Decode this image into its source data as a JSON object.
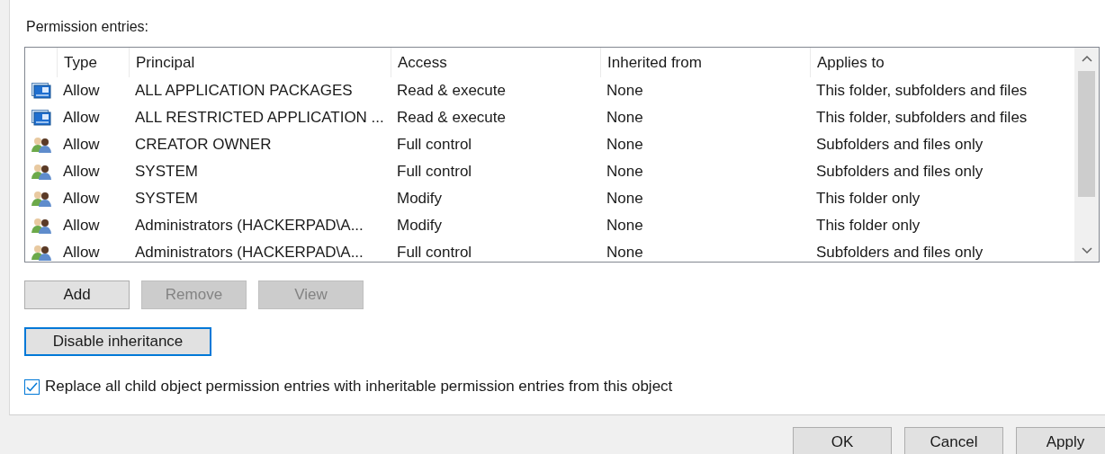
{
  "section_label": "Permission entries:",
  "table": {
    "columns": [
      "Type",
      "Principal",
      "Access",
      "Inherited from",
      "Applies to"
    ],
    "rows": [
      {
        "kind": "app",
        "type": "Allow",
        "principal": "ALL APPLICATION PACKAGES",
        "access": "Read & execute",
        "inherited_from": "None",
        "applies_to": "This folder, subfolders and files"
      },
      {
        "kind": "app",
        "type": "Allow",
        "principal": "ALL RESTRICTED APPLICATION ...",
        "access": "Read & execute",
        "inherited_from": "None",
        "applies_to": "This folder, subfolders and files"
      },
      {
        "kind": "users",
        "type": "Allow",
        "principal": "CREATOR OWNER",
        "access": "Full control",
        "inherited_from": "None",
        "applies_to": "Subfolders and files only"
      },
      {
        "kind": "users",
        "type": "Allow",
        "principal": "SYSTEM",
        "access": "Full control",
        "inherited_from": "None",
        "applies_to": "Subfolders and files only"
      },
      {
        "kind": "users",
        "type": "Allow",
        "principal": "SYSTEM",
        "access": "Modify",
        "inherited_from": "None",
        "applies_to": "This folder only"
      },
      {
        "kind": "users",
        "type": "Allow",
        "principal": "Administrators (HACKERPAD\\A...",
        "access": "Modify",
        "inherited_from": "None",
        "applies_to": "This folder only"
      },
      {
        "kind": "users",
        "type": "Allow",
        "principal": "Administrators (HACKERPAD\\A...",
        "access": "Full control",
        "inherited_from": "None",
        "applies_to": "Subfolders and files only"
      }
    ]
  },
  "entry_buttons": [
    {
      "label": "Add",
      "disabled": false
    },
    {
      "label": "Remove",
      "disabled": true
    },
    {
      "label": "View",
      "disabled": true
    }
  ],
  "inheritance_button": {
    "label": "Disable inheritance",
    "focused": true
  },
  "replace_checkbox": {
    "label": "Replace all child object permission entries with inheritable permission entries from this object",
    "checked": true
  },
  "dialog_buttons": [
    "OK",
    "Cancel",
    "Apply"
  ]
}
